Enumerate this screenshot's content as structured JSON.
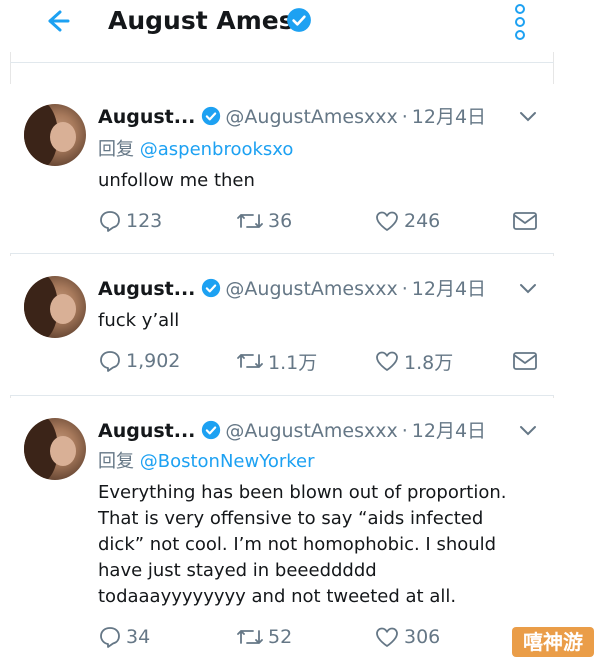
{
  "header": {
    "title": "August Ames",
    "back_icon": "arrow-left-icon",
    "menu_icon": "kebab-menu-icon",
    "accent": "#1da1f2"
  },
  "tweets": [
    {
      "name": "August...",
      "handle": "@AugustAmesxxx",
      "dot": "·",
      "date": "12月4日",
      "reply_label": "回复",
      "reply_to": "@aspenbrooksxo",
      "text": "unfollow me then",
      "replies": "123",
      "retweets": "36",
      "likes": "246"
    },
    {
      "name": "August...",
      "handle": "@AugustAmesxxx",
      "dot": "·",
      "date": "12月4日",
      "text": "fuck y’all",
      "replies": "1,902",
      "retweets": "1.1万",
      "likes": "1.8万"
    },
    {
      "name": "August...",
      "handle": "@AugustAmesxxx",
      "dot": "·",
      "date": "12月4日",
      "reply_label": "回复",
      "reply_to": "@BostonNewYorker",
      "text_lines": [
        "Everything has been blown out of proportion.",
        "That is very offensive to say “aids infected",
        "dick” not cool. I’m not homophobic. I should",
        "have just stayed in beeeddddd",
        "todaaayyyyyyyy and not tweeted at all."
      ],
      "replies": "34",
      "retweets": "52",
      "likes": "306"
    }
  ],
  "watermark": "嘻神游"
}
